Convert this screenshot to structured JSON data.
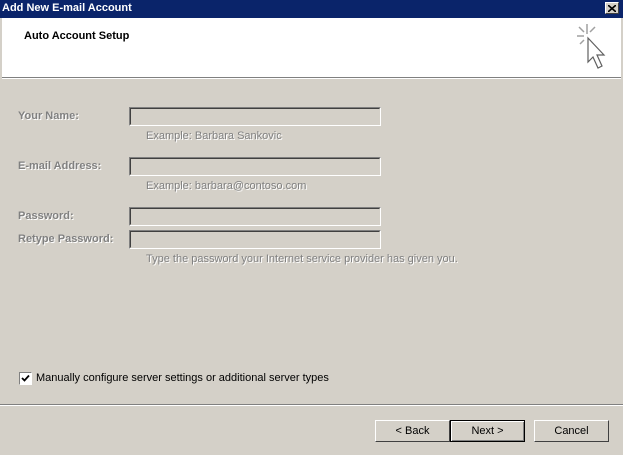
{
  "window": {
    "title": "Add New E-mail Account",
    "close_symbol": "✕"
  },
  "header": {
    "heading": "Auto Account Setup",
    "icon": "cursor-sparkle-icon"
  },
  "form": {
    "name_label": "Your Name:",
    "name_value": "",
    "name_hint": "Example: Barbara Sankovic",
    "email_label": "E-mail Address:",
    "email_value": "",
    "email_hint": "Example: barbara@contoso.com",
    "password_label": "Password:",
    "password_value": "",
    "retype_label": "Retype Password:",
    "retype_value": "",
    "password_hint": "Type the password your Internet service provider has given you."
  },
  "manual_config": {
    "checked": true,
    "label": "Manually configure server settings or additional server types"
  },
  "buttons": {
    "back": "< Back",
    "next": "Next >",
    "cancel": "Cancel"
  }
}
